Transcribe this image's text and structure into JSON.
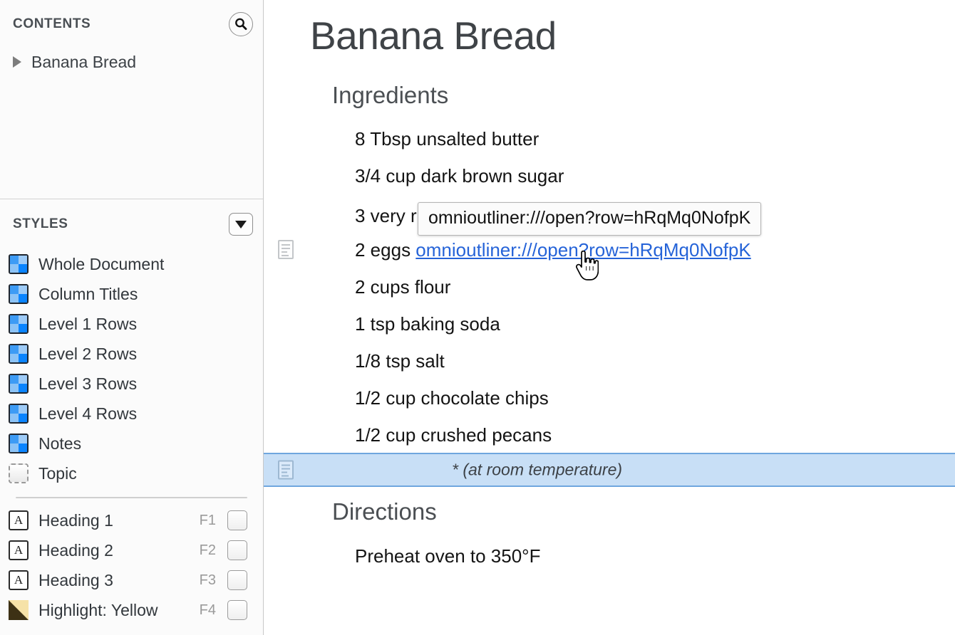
{
  "sidebar": {
    "contents": {
      "title": "CONTENTS",
      "search_icon": "search-icon",
      "items": [
        {
          "label": "Banana Bread",
          "expanded": false,
          "disclosure_icon": "triangle-right-icon"
        }
      ]
    },
    "styles": {
      "title": "STYLES",
      "menu_icon": "chevron-down-icon",
      "items": [
        {
          "label": "Whole Document",
          "icon": "style-swatch-icon"
        },
        {
          "label": "Column Titles",
          "icon": "style-swatch-icon"
        },
        {
          "label": "Level 1 Rows",
          "icon": "style-swatch-icon"
        },
        {
          "label": "Level 2 Rows",
          "icon": "style-swatch-icon"
        },
        {
          "label": "Level 3 Rows",
          "icon": "style-swatch-icon"
        },
        {
          "label": "Level 4 Rows",
          "icon": "style-swatch-icon"
        },
        {
          "label": "Notes",
          "icon": "style-swatch-icon"
        },
        {
          "label": "Topic",
          "icon": "style-swatch-dashed-icon"
        }
      ],
      "named_styles": [
        {
          "label": "Heading 1",
          "shortcut": "F1",
          "icon": "letter-a-icon"
        },
        {
          "label": "Heading 2",
          "shortcut": "F2",
          "icon": "letter-a-icon"
        },
        {
          "label": "Heading 3",
          "shortcut": "F3",
          "icon": "letter-a-icon"
        },
        {
          "label": "Highlight: Yellow",
          "shortcut": "F4",
          "icon": "highlight-swatch-icon"
        }
      ]
    }
  },
  "document": {
    "title": "Banana Bread",
    "sections": [
      {
        "heading": "Ingredients"
      },
      {
        "heading": "Directions"
      }
    ],
    "ingredients": [
      "8 Tbsp unsalted butter",
      "3/4 cup dark brown sugar",
      "3 very ripe bananas",
      "2 eggs ",
      "2 cups flour",
      "1 tsp baking soda",
      "1/8 tsp salt",
      "1/2 cup chocolate chips",
      "1/2 cup crushed pecans"
    ],
    "eggs_row_prefix": "2 eggs ",
    "link_text": "omnioutliner:///open?row=hRqMq0NofpK",
    "note_row": "* (at room temperature)",
    "directions": [
      "Preheat oven to 350°F"
    ]
  },
  "tooltip": {
    "text": "omnioutliner:///open?row=hRqMq0NofpK"
  },
  "colors": {
    "link": "#2563d8",
    "selection": "#c8dff6",
    "selection_border": "#6fa6de",
    "swatch_blue": "#0a84ff",
    "highlight_yellow": "#f6e2a8"
  }
}
